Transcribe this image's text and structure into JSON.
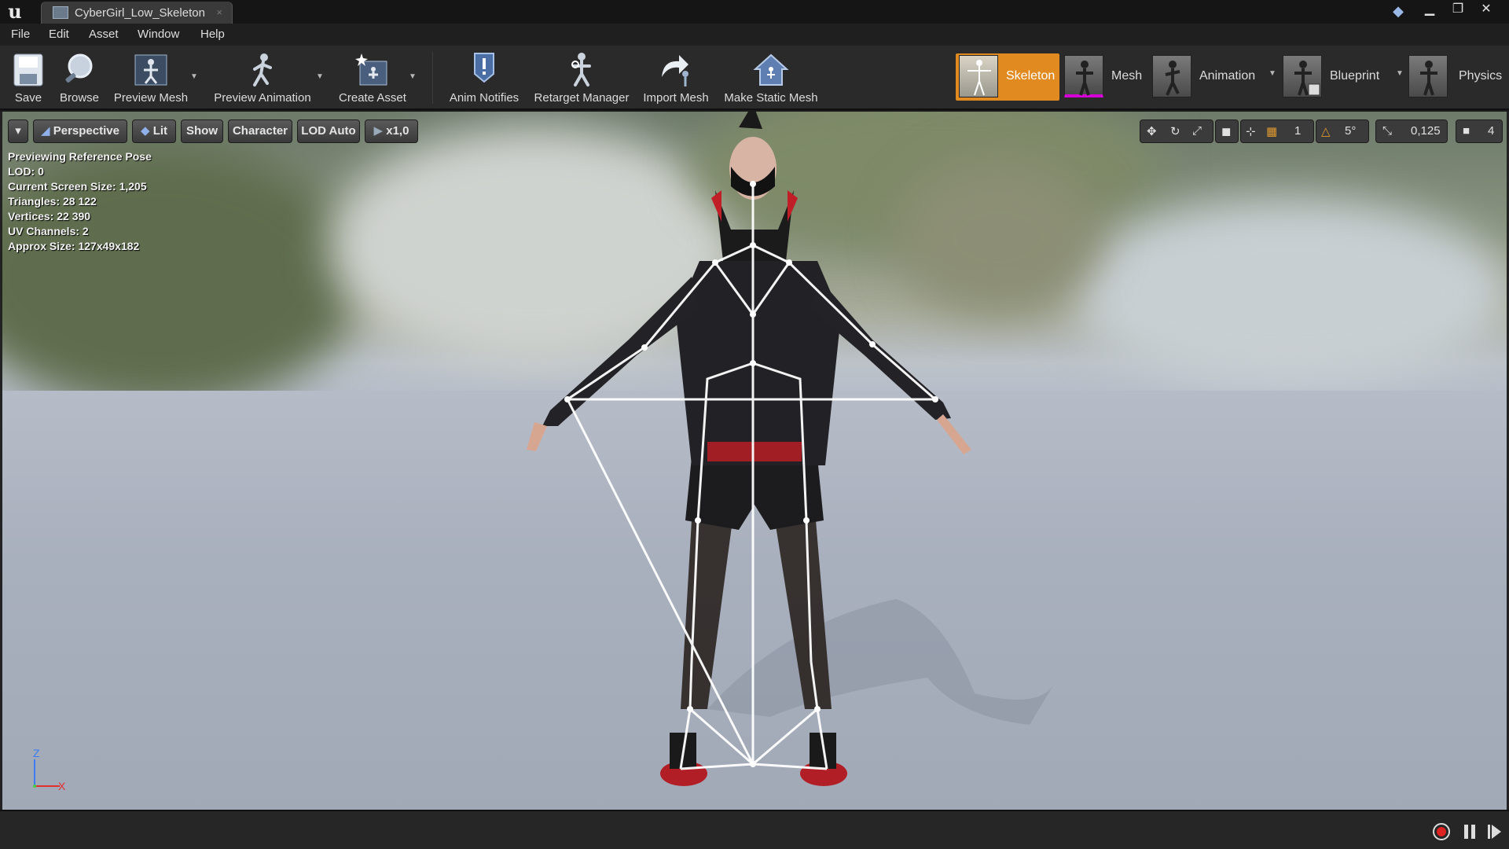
{
  "window": {
    "tab_title": "CyberGirl_Low_Skeleton",
    "tab_close": "×",
    "minimize": "▁",
    "maximize": "❐",
    "close": "✕"
  },
  "menu": [
    "File",
    "Edit",
    "Asset",
    "Window",
    "Help"
  ],
  "toolbar": {
    "save": "Save",
    "browse": "Browse",
    "preview_mesh": "Preview Mesh",
    "preview_animation": "Preview Animation",
    "create_asset": "Create Asset",
    "anim_notifies": "Anim Notifies",
    "retarget_manager": "Retarget Manager",
    "import_mesh": "Import Mesh",
    "make_static_mesh": "Make Static Mesh"
  },
  "modes": {
    "skeleton": "Skeleton",
    "mesh": "Mesh",
    "animation": "Animation",
    "blueprint": "Blueprint",
    "physics": "Physics",
    "active": "skeleton",
    "active_color": "#e08a20"
  },
  "viewport": {
    "perspective": "Perspective",
    "lit": "Lit",
    "show": "Show",
    "character": "Character",
    "lod": "LOD Auto",
    "speed": "x1,0",
    "grid_snap": "1",
    "rotation_snap": "5°",
    "scale_snap": "0,125",
    "camera_speed": "4"
  },
  "stats": [
    "Previewing Reference Pose",
    "LOD: 0",
    "Current Screen Size: 1,205",
    "Triangles: 28 122",
    "Vertices: 22 390",
    "UV Channels: 2",
    "Approx Size: 127x49x182"
  ],
  "axis": {
    "z": "Z",
    "x": "X"
  }
}
